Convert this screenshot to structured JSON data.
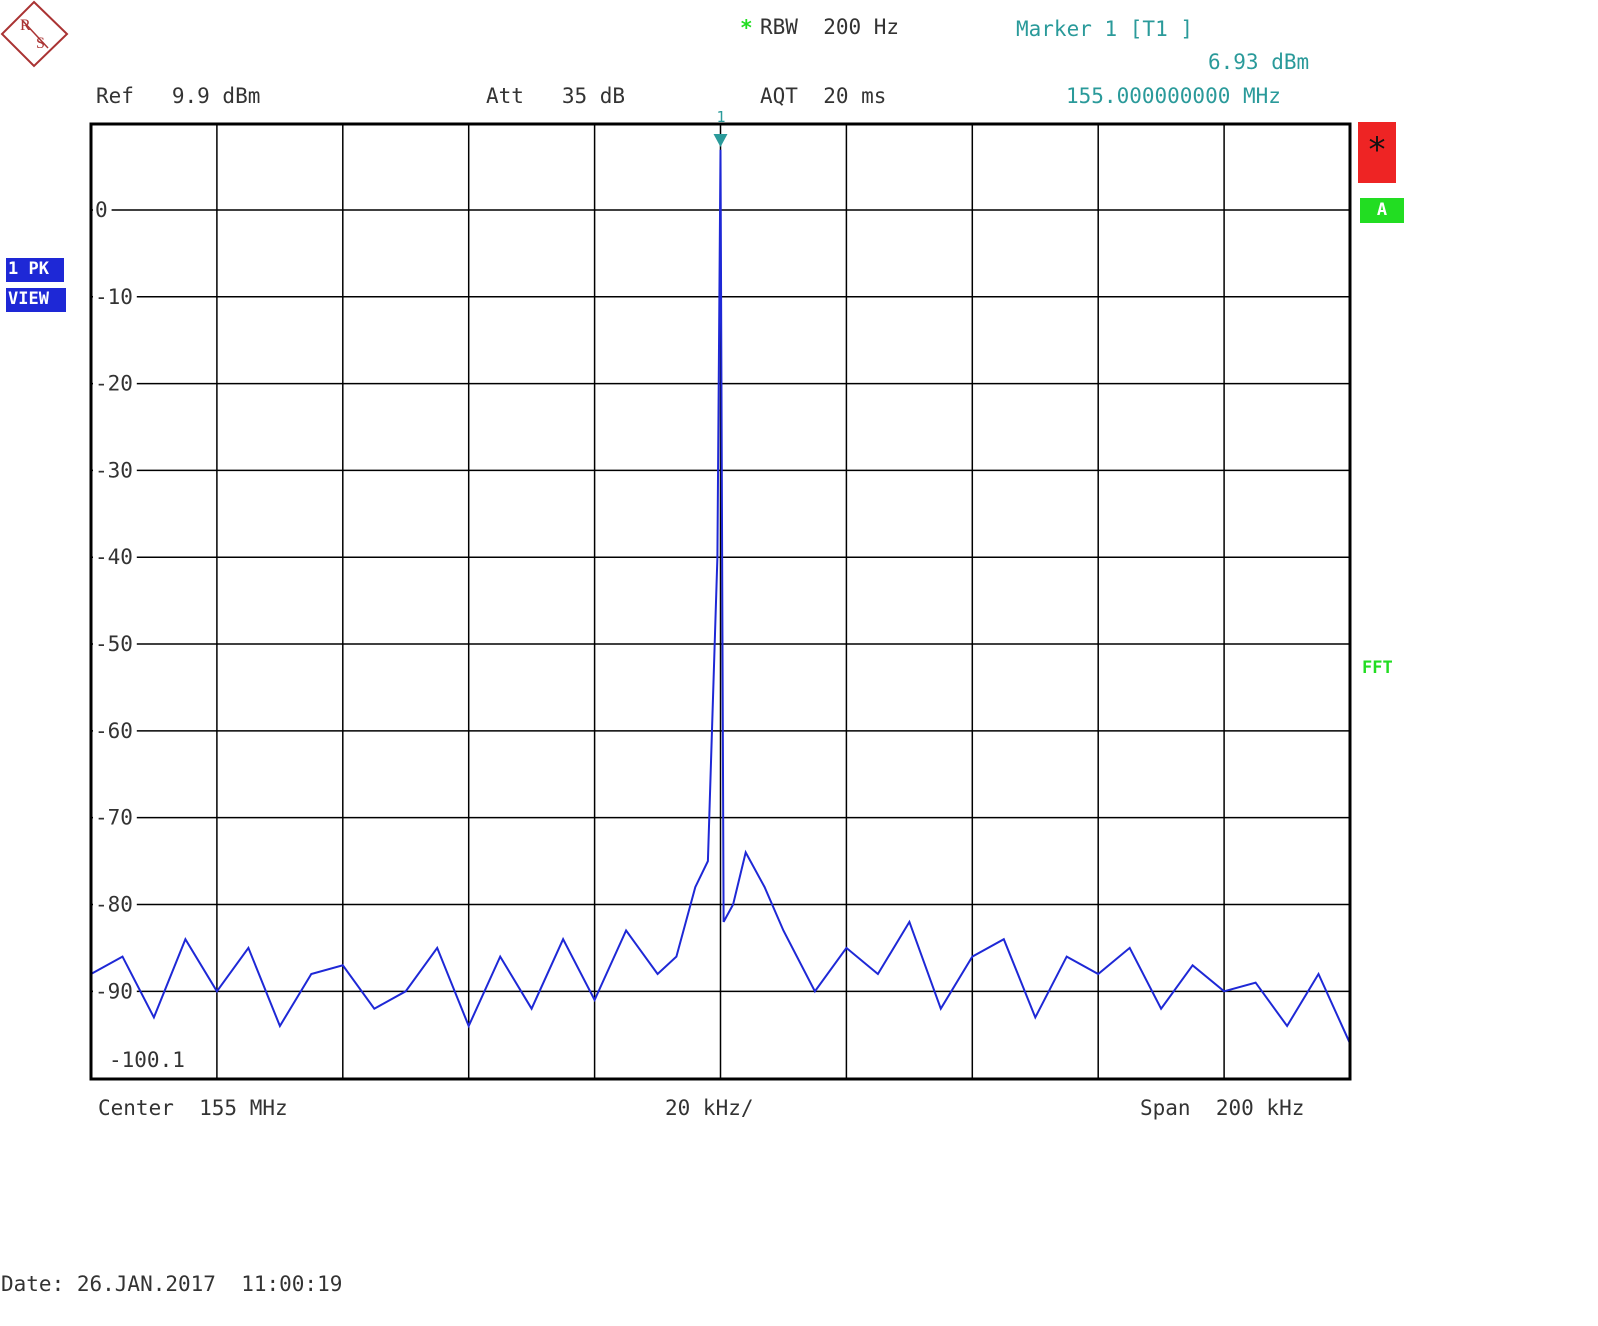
{
  "header": {
    "rbw_star": "*",
    "rbw": "RBW  200 Hz",
    "marker_title": "Marker 1 [T1 ]",
    "marker_level": "6.93 dBm",
    "marker_freq": "155.000000000 MHz",
    "ref": "Ref   9.9 dBm",
    "att": "Att   35 dB",
    "aqt": "AQT  20 ms"
  },
  "side": {
    "trace_mode": "1 PK",
    "view": "VIEW",
    "star": "*",
    "a_label": "A",
    "fft": "FFT"
  },
  "footer": {
    "center": "Center  155 MHz",
    "div": "20 kHz/",
    "span": "Span  200 kHz",
    "date": "Date: 26.JAN.2017  11:00:19"
  },
  "logo": {
    "letters": [
      "R",
      "S"
    ]
  },
  "colors": {
    "trace": "#1e28d6",
    "marker": "#2a9a9a",
    "grid": "#000000",
    "status_red": "#ee2424",
    "status_green": "#22dd22"
  },
  "chart_data": {
    "type": "line",
    "title": "",
    "xlabel": "",
    "ylabel": "",
    "unit_x": "MHz",
    "unit_y": "dBm",
    "xlim": [
      154.9,
      155.1
    ],
    "ylim": [
      -100.1,
      9.9
    ],
    "y_ticks": [
      0,
      -10,
      -20,
      -30,
      -40,
      -50,
      -60,
      -70,
      -80,
      -90
    ],
    "y_tick_labels": [
      "0",
      "-10",
      "-20",
      "-30",
      "-40",
      "-50",
      "-60",
      "-70",
      "-80",
      "-90"
    ],
    "y_bottom_label": "-100.1",
    "grid": true,
    "marker": {
      "label": "1",
      "x": 155.0,
      "y": 6.93
    },
    "series": [
      {
        "x": [
          154.9,
          154.905,
          154.91,
          154.915,
          154.92,
          154.925,
          154.93,
          154.935,
          154.94,
          154.945,
          154.95,
          154.955,
          154.96,
          154.965,
          154.97,
          154.975,
          154.98,
          154.985,
          154.99,
          154.993,
          154.996,
          154.998,
          154.9995,
          155.0,
          155.0005,
          155.002,
          155.004,
          155.007,
          155.01,
          155.015,
          155.02,
          155.025,
          155.03,
          155.035,
          155.04,
          155.045,
          155.05,
          155.055,
          155.06,
          155.065,
          155.07,
          155.075,
          155.08,
          155.085,
          155.09,
          155.095,
          155.1
        ],
        "y": [
          -88,
          -86,
          -93,
          -84,
          -90,
          -85,
          -94,
          -88,
          -87,
          -92,
          -90,
          -85,
          -94,
          -86,
          -92,
          -84,
          -91,
          -83,
          -88,
          -86,
          -78,
          -75,
          -40,
          6.93,
          -82,
          -80,
          -74,
          -78,
          -83,
          -90,
          -85,
          -88,
          -82,
          -92,
          -86,
          -84,
          -93,
          -86,
          -88,
          -85,
          -92,
          -87,
          -90,
          -89,
          -94,
          -88,
          -96
        ]
      }
    ]
  }
}
